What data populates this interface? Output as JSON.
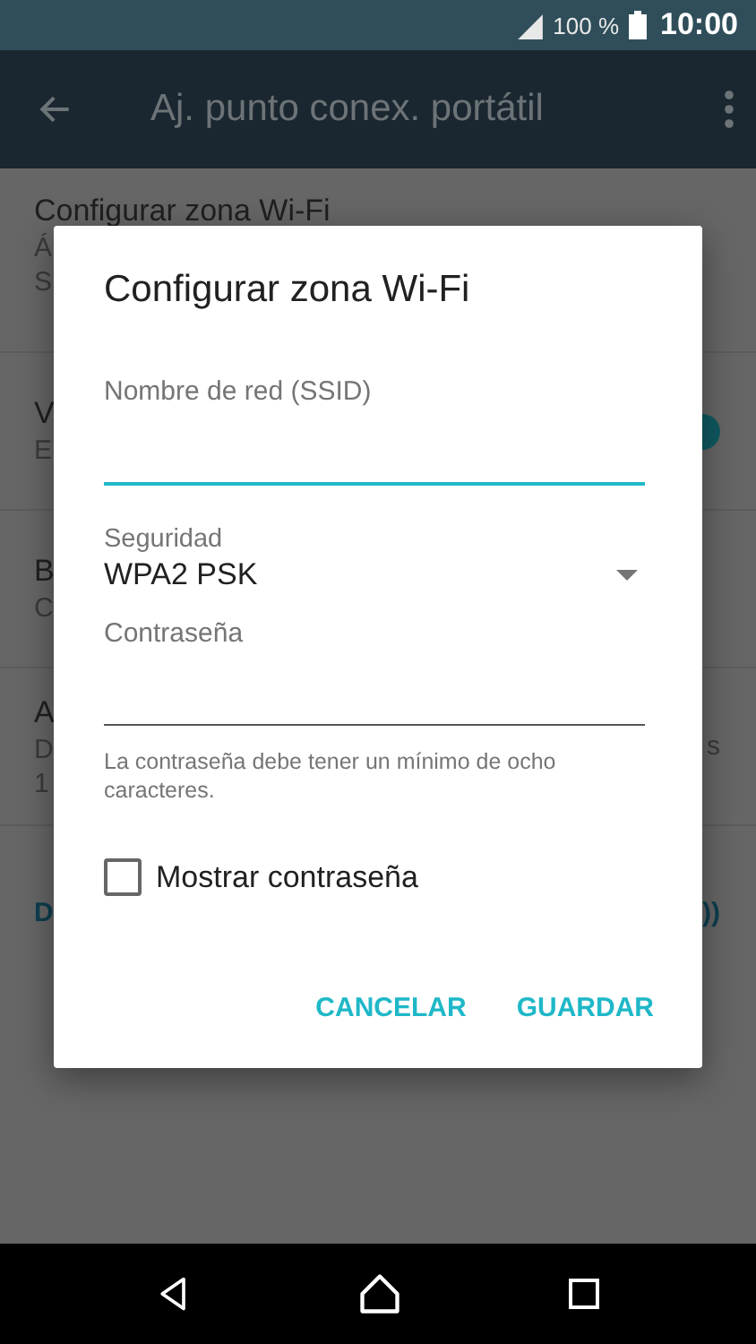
{
  "status_bar": {
    "battery": "100 %",
    "time": "10:00"
  },
  "app_bar": {
    "title": "Aj. punto conex. portátil"
  },
  "background_list": [
    {
      "title": "Configurar zona Wi-Fi",
      "lines": [
        "Á",
        "S"
      ]
    },
    {
      "title": "V",
      "lines": [
        "E"
      ],
      "toggle": {
        "on": true
      }
    },
    {
      "title": "B",
      "lines": [
        "C"
      ]
    },
    {
      "title": "A",
      "lines": [
        "D",
        "1"
      ],
      "right": "s"
    }
  ],
  "background_link": {
    "left": "D",
    "right": "))"
  },
  "dialog": {
    "title": "Configurar zona Wi-Fi",
    "ssid": {
      "placeholder": "Nombre de red (SSID)",
      "focused": true
    },
    "security": {
      "label": "Seguridad",
      "value": "WPA2 PSK"
    },
    "password": {
      "placeholder": "Contraseña",
      "helper": "La contraseña debe tener un mínimo de ocho caracteres."
    },
    "show_password": {
      "label": "Mostrar contraseña",
      "checked": false
    },
    "buttons": [
      "CANCELAR",
      "GUARDAR"
    ]
  }
}
